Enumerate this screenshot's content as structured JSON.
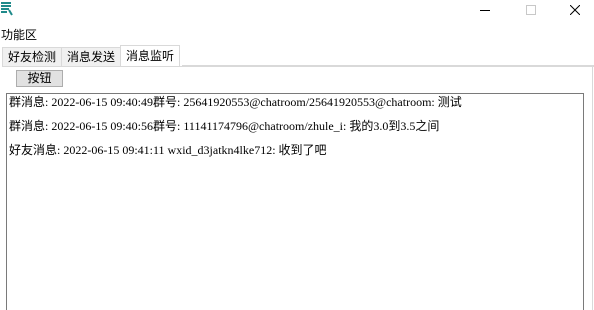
{
  "window": {
    "icon": "app-icon",
    "controls": {
      "minimize_icon": "minimize-icon",
      "maximize_icon": "maximize-icon",
      "close_icon": "close-icon"
    }
  },
  "menu": {
    "label": "功能区"
  },
  "tabs": [
    {
      "label": "好友检测",
      "active": false
    },
    {
      "label": "消息发送",
      "active": false
    },
    {
      "label": "消息监听",
      "active": true
    }
  ],
  "panel": {
    "button_label": "按钮",
    "log_lines": [
      "群消息: 2022-06-15 09:40:49群号: 25641920553@chatroom/25641920553@chatroom: 测试",
      "群消息: 2022-06-15 09:40:56群号: 11141174796@chatroom/zhule_i: 我的3.0到3.5之间",
      "好友消息: 2022-06-15 09:41:11 wxid_d3jatkn4lke712: 收到了吧"
    ]
  },
  "colors": {
    "tab_border": "#d9d9d9",
    "button_bg": "#e1e1e1",
    "button_border": "#adadad",
    "log_border": "#7a7a7a",
    "icon_teal": "#1f8a8a"
  }
}
